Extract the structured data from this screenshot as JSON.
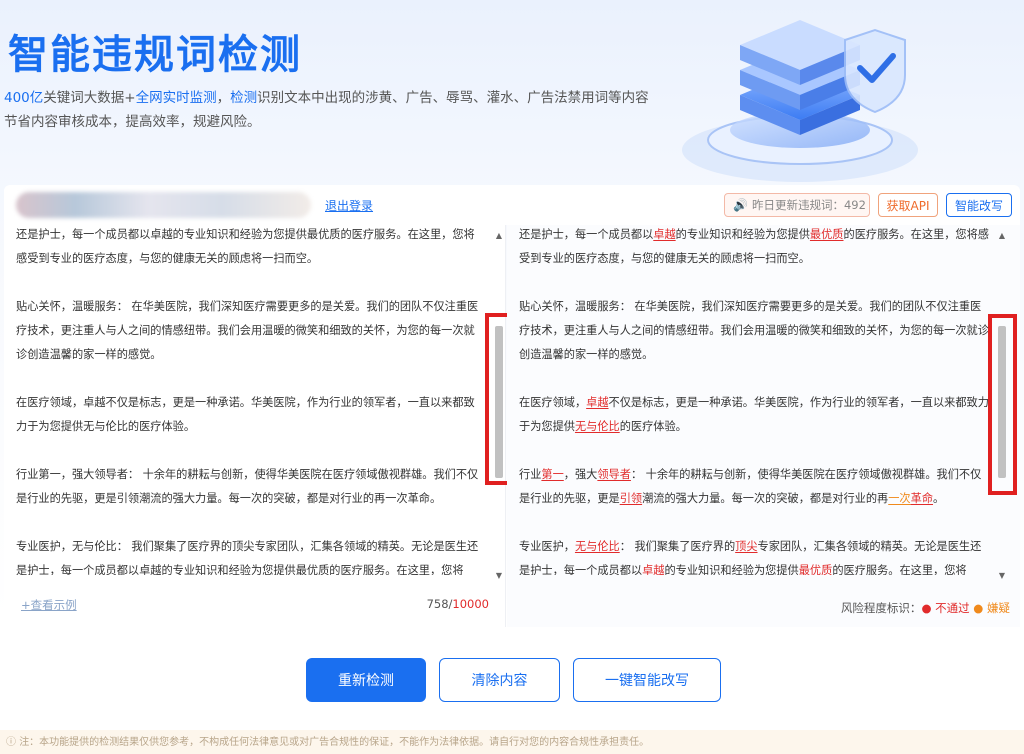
{
  "hero": {
    "title": "智能违规词检测",
    "desc_part1": "400亿",
    "desc_part2": "关键词大数据+",
    "desc_part3": "全网实时监测",
    "desc_part4": "，",
    "desc_part5": "检测",
    "desc_part6": "识别文本中出现的涉黄、广告、辱骂、灌水、广告法禁用词等内容",
    "desc_line2": "节省内容审核成本，提高效率，规避风险。"
  },
  "toolbar": {
    "logout": "退出登录",
    "update_label": "昨日更新违规词：492",
    "api_button": "获取API",
    "rewrite_button": "智能改写"
  },
  "left_panel": {
    "paragraphs": [
      "还是护士，每一个成员都以卓越的专业知识和经验为您提供最优质的医疗服务。在这里，您将感受到专业的医疗态度，与您的健康无关的顾虑将一扫而空。",
      "贴心关怀，温暖服务： 在华美医院，我们深知医疗需要更多的是关爱。我们的团队不仅注重医疗技术，更注重人与人之间的情感纽带。我们会用温暖的微笑和细致的关怀，为您的每一次就诊创造温馨的家一样的感觉。",
      "在医疗领域，卓越不仅是标志，更是一种承诺。华美医院，作为行业的领军者，一直以来都致力于为您提供无与伦比的医疗体验。",
      "行业第一，强大领导者： 十余年的耕耘与创新，使得华美医院在医疗领域傲视群雄。我们不仅是行业的先驱，更是引领潮流的强大力量。每一次的突破，都是对行业的再一次革命。",
      "专业医护，无与伦比： 我们聚集了医疗界的顶尖专家团队，汇集各领域的精英。无论是医生还是护士，每一个成员都以卓越的专业知识和经验为您提供最优质的医疗服务。在这里，您将"
    ],
    "sample_link": "+查看示例",
    "count": "758",
    "max": "10000"
  },
  "right_panel": {
    "p1": {
      "a": "还是护士，每一个成员都以",
      "r1": "卓越",
      "b": "的专业知识和经验为您提供",
      "r2": "最优质",
      "c": "的医疗服务。在这里，您将感受到专业的医疗态度，与您的健康无关的顾虑将一扫而空。"
    },
    "p2": "贴心关怀，温暖服务： 在华美医院，我们深知医疗需要更多的是关爱。我们的团队不仅注重医疗技术，更注重人与人之间的情感纽带。我们会用温暖的微笑和细致的关怀，为您的每一次就诊创造温馨的家一样的感觉。",
    "p3": {
      "a": "在医疗领域，",
      "r1": "卓越",
      "b": "不仅是标志，更是一种承诺。华美医院，作为行业的领军者，一直以来都致力于为您提供",
      "r2": "无与伦比",
      "c": "的医疗体验。"
    },
    "p4": {
      "a": "行业",
      "r1": "第一",
      "b": "，强大",
      "r2": "领导者",
      "c": "： 十余年的耕耘与创新，使得华美医院在医疗领域傲视群雄。我们不仅是行业的先驱，更是",
      "r3": "引领",
      "d": "潮流的强大力量。每一次的突破，都是对行业的再",
      "o1": "一次",
      "r4": "革命",
      "e": "。"
    },
    "p5": {
      "a": "专业医护，",
      "r1": "无与伦比",
      "b": "： 我们聚集了医疗界的",
      "r2": "顶尖",
      "c": "专家团队，汇集各领域的精英。无论是医生还是护士，每一个成员都以",
      "r3": "卓越",
      "d": "的专业知识和经验为您提供",
      "r4": "最优质",
      "e": "的医疗服务。在这里，您将"
    },
    "legend_label": "风险程度标识：",
    "legend_fail": "不通过",
    "legend_suspect": "嫌疑"
  },
  "actions": {
    "recheck": "重新检测",
    "clear": "清除内容",
    "ai_rewrite": "一键智能改写"
  },
  "notice": "注：本功能提供的检测结果仅供您参考，不构成任何法律意见或对广告合规性的保证，不能作为法律依据。请自行对您的内容合规性承担责任。",
  "colors": {
    "brand": "#1a6ff0",
    "fail": "#e12b2b",
    "suspect": "#f08a1c"
  }
}
